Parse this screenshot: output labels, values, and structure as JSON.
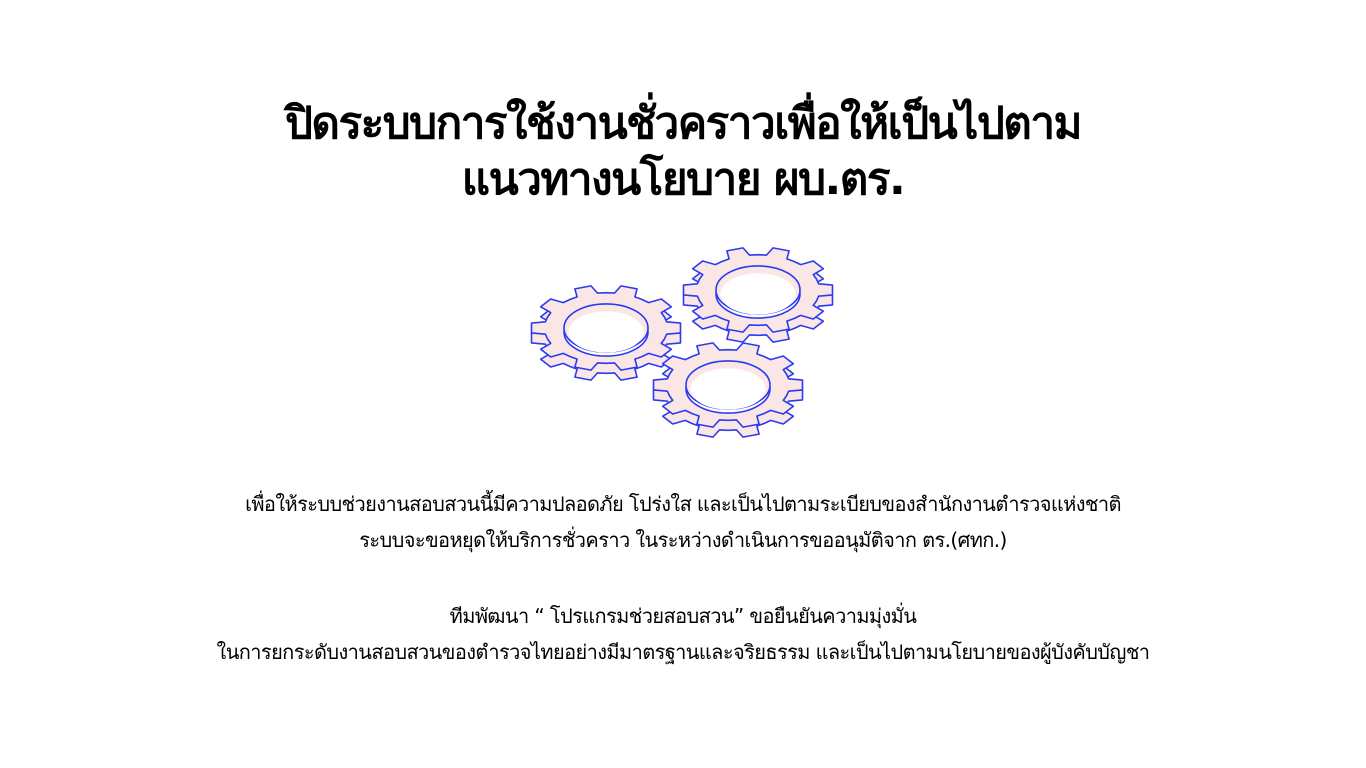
{
  "notice": {
    "title_line_1": "ปิดระบบการใช้งานชั่วคราวเพื่อให้เป็นไปตาม",
    "title_line_2": "แนวทางนโยบาย ผบ.ตร.",
    "illustration_icon": "gears-icon",
    "body_line_1": "เพื่อให้ระบบช่วยงานสอบสวนนี้มีความปลอดภัย โปร่งใส และเป็นไปตามระเบียบของสำนักงานตำรวจแห่งชาติ",
    "body_line_2": "ระบบจะขอหยุดให้บริการชั่วคราว ในระหว่างดำเนินการขออนุมัติจาก ตร.(ศทก.)",
    "body_line_3": "ทีมพัฒนา “ โปรแกรมช่วยสอบสวน” ขอยืนยันความมุ่งมั่น",
    "body_line_4": "ในการยกระดับงานสอบสวนของตำรวจไทยอย่างมีมาตรฐานและจริยธรรม และเป็นไปตามนโยบายของผู้บังคับบัญชา"
  },
  "colors": {
    "gear_fill": "#fbe6e6",
    "gear_stroke": "#2b3bf0",
    "text": "#000000",
    "background": "#ffffff"
  }
}
